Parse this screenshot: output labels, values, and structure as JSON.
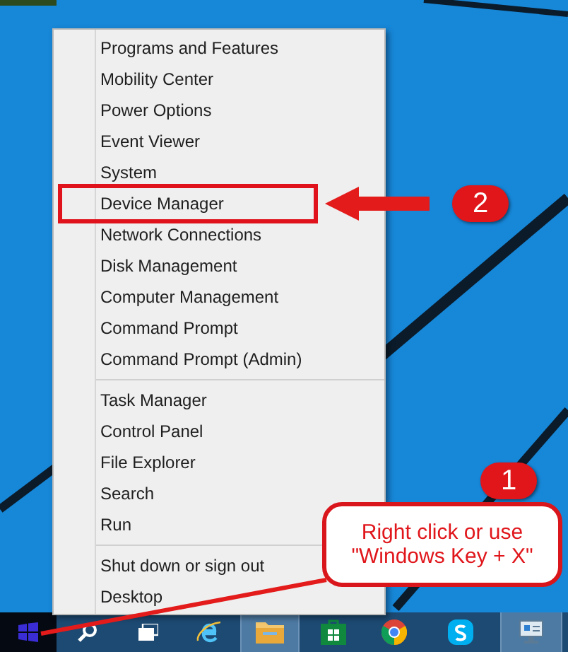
{
  "context_menu": {
    "groups": [
      {
        "items": [
          {
            "label": "Programs and Features",
            "highlighted": false
          },
          {
            "label": "Mobility Center",
            "highlighted": false
          },
          {
            "label": "Power Options",
            "highlighted": false
          },
          {
            "label": "Event Viewer",
            "highlighted": false
          },
          {
            "label": "System",
            "highlighted": false
          },
          {
            "label": "Device Manager",
            "highlighted": true
          },
          {
            "label": "Network Connections",
            "highlighted": false
          },
          {
            "label": "Disk Management",
            "highlighted": false
          },
          {
            "label": "Computer Management",
            "highlighted": false
          },
          {
            "label": "Command Prompt",
            "highlighted": false
          },
          {
            "label": "Command Prompt (Admin)",
            "highlighted": false
          }
        ]
      },
      {
        "items": [
          {
            "label": "Task Manager",
            "highlighted": false
          },
          {
            "label": "Control Panel",
            "highlighted": false
          },
          {
            "label": "File Explorer",
            "highlighted": false
          },
          {
            "label": "Search",
            "highlighted": false
          },
          {
            "label": "Run",
            "highlighted": false
          }
        ]
      },
      {
        "items": [
          {
            "label": "Shut down or sign out",
            "highlighted": false
          },
          {
            "label": "Desktop",
            "highlighted": false
          }
        ]
      }
    ]
  },
  "annotations": {
    "step_2": "2",
    "step_1": "1",
    "callout": "Right click or use \"Windows Key + X\""
  },
  "taskbar": {
    "buttons": [
      {
        "kind": "start",
        "active": false
      },
      {
        "kind": "search",
        "active": false
      },
      {
        "kind": "task-view",
        "active": false
      },
      {
        "kind": "browser",
        "active": false
      },
      {
        "kind": "folder",
        "active": true
      },
      {
        "kind": "store",
        "active": false
      },
      {
        "kind": "chrome",
        "active": false
      },
      {
        "kind": "chat",
        "active": false
      },
      {
        "kind": "network",
        "active": true
      }
    ]
  }
}
